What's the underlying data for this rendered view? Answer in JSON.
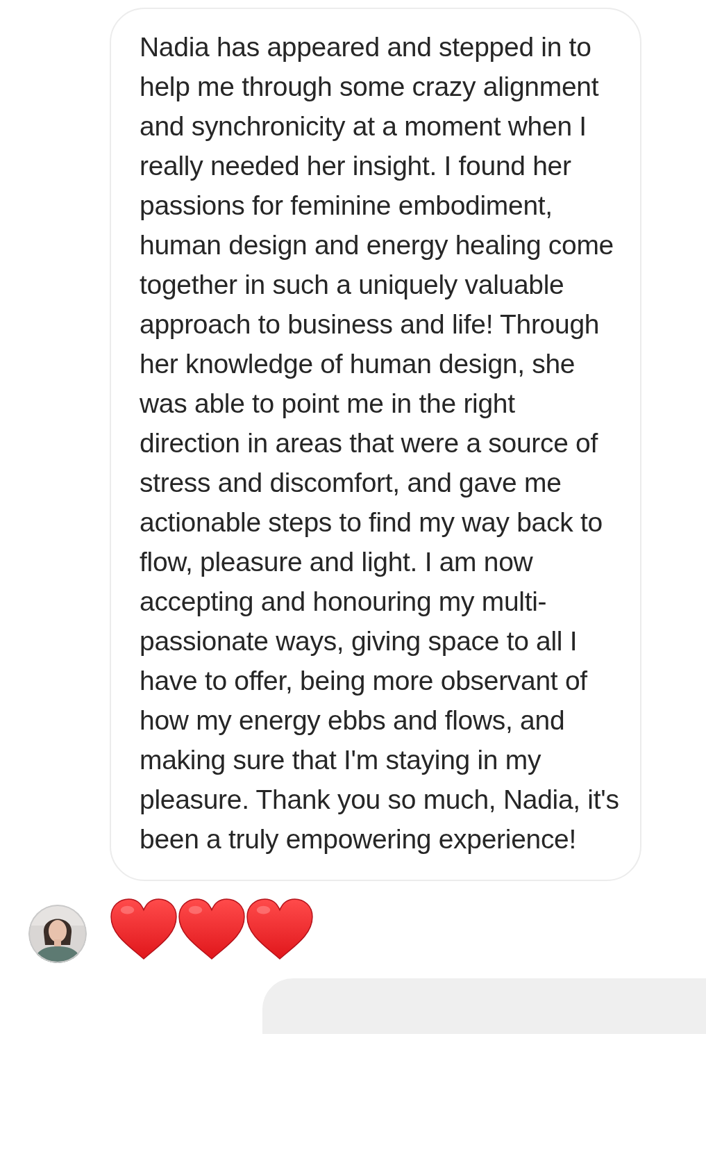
{
  "messages": [
    {
      "kind": "incoming_text",
      "text": "Nadia has appeared and stepped in to help me through some crazy alignment and synchronicity at a moment when I really needed her insight. I found her passions for feminine embodiment, human design and energy healing come together in such a uniquely valuable approach to business and life! Through her knowledge of human design, she was able to point me in the right direction in areas that were a source of stress and discomfort, and gave me actionable steps to find my way back to flow, pleasure and light. I am now accepting and honouring my multi-passionate ways, giving space to all I have to offer, being more observant of how my energy ebbs and flows, and making sure that I'm staying in my pleasure. Thank you so much, Nadia, it's been a truly empowering experience!"
    },
    {
      "kind": "incoming_reaction",
      "reactions": [
        {
          "kind": "heart"
        },
        {
          "kind": "heart"
        },
        {
          "kind": "heart"
        }
      ]
    },
    {
      "kind": "outgoing_cut"
    }
  ]
}
